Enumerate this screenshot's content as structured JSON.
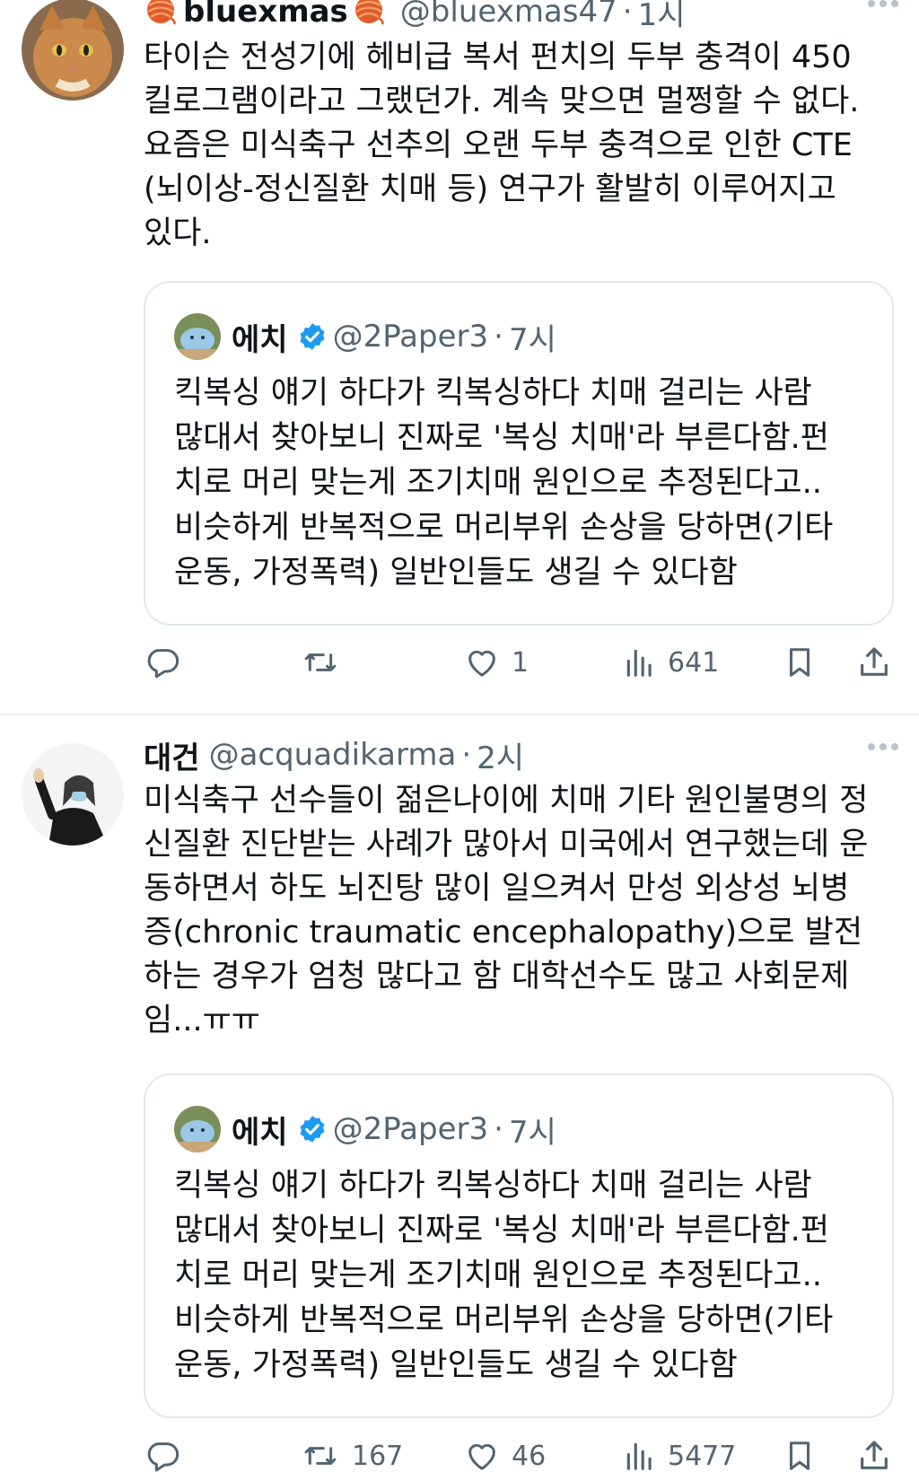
{
  "colors": {
    "text": "#0f1419",
    "muted": "#536471",
    "border": "#e1e8ed",
    "verified": "#1d9bf0",
    "yarn": "#e25b2b"
  },
  "tweets": [
    {
      "name": "bluexmas",
      "handle": "@bluexmas47",
      "dot": "·",
      "time": "1시",
      "more": "···",
      "body_lines": [
        "타이슨 전성기에 헤비급 복서 펀치의 두부 충격이 450",
        "킬로그램이라고 그랬던가. 계속 맞으면 멀쩡할 수 없다.",
        "요즘은 미식축구 선추의 오랜 두부 충격으로 인한 CTE",
        "(뇌이상-정신질환 치매 등) 연구가 활발히 이루어지고",
        "있다."
      ],
      "quote": {
        "name": "에치",
        "handle": "@2Paper3",
        "dot": "·",
        "time": "7시",
        "body_lines": [
          "킥복싱 얘기 하다가 킥복싱하다 치매 걸리는 사람",
          "많대서 찾아보니 진짜로 '복싱 치매'라 부른다함.펀",
          "치로 머리 맞는게 조기치매 원인으로 추정된다고..",
          "비슷하게 반복적으로 머리부위 손상을 당하면(기타",
          "운동, 가정폭력) 일반인들도 생길 수 있다함"
        ]
      },
      "actions": {
        "reply": "",
        "retweet": "",
        "like": "1",
        "views": "641"
      }
    },
    {
      "name": "대건",
      "handle": "@acquadikarma",
      "dot": "·",
      "time": "2시",
      "more": "···",
      "body_lines": [
        "미식축구 선수들이 젊은나이에 치매 기타 원인불명의 정",
        "신질환 진단받는 사례가 많아서 미국에서 연구했는데 운",
        "동하면서 하도 뇌진탕 많이 일으켜서 만성 외상성 뇌병",
        "증(chronic traumatic encephalopathy)으로 발전",
        "하는 경우가 엄청 많다고 함 대학선수도 많고 사회문제",
        "임...ㅠㅠ"
      ],
      "quote": {
        "name": "에치",
        "handle": "@2Paper3",
        "dot": "·",
        "time": "7시",
        "body_lines": [
          "킥복싱 얘기 하다가 킥복싱하다 치매 걸리는 사람",
          "많대서 찾아보니 진짜로 '복싱 치매'라 부른다함.펀",
          "치로 머리 맞는게 조기치매 원인으로 추정된다고..",
          "비슷하게 반복적으로 머리부위 손상을 당하면(기타",
          "운동, 가정폭력) 일반인들도 생길 수 있다함"
        ]
      },
      "actions": {
        "reply": "",
        "retweet": "167",
        "like": "46",
        "views": "5477"
      }
    }
  ]
}
